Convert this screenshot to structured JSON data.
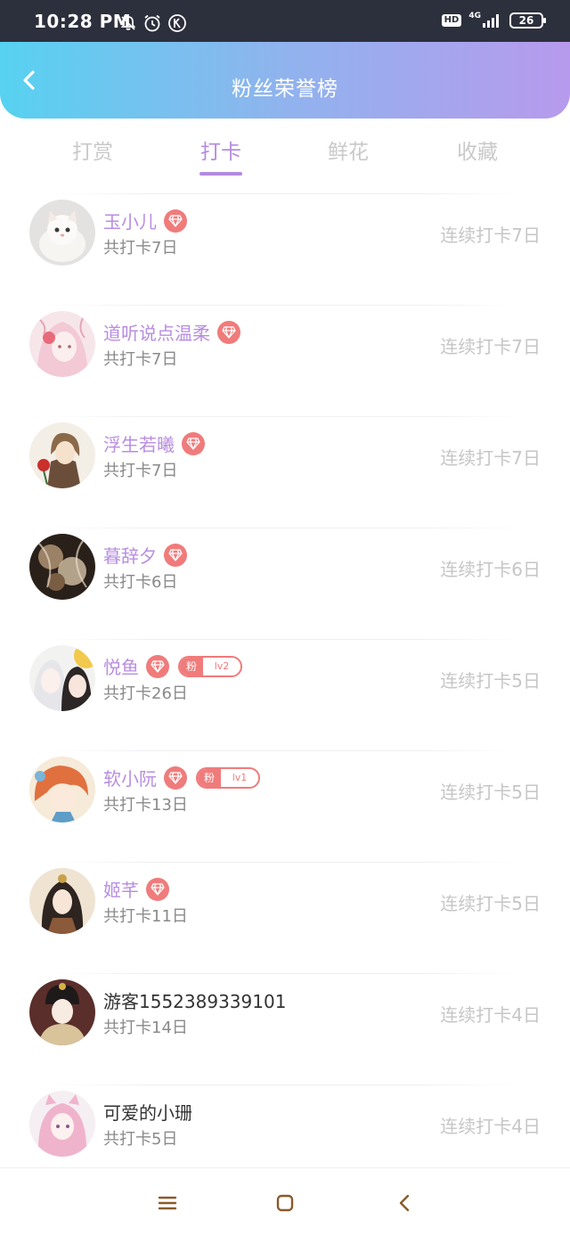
{
  "status_bar": {
    "time": "10:28 PM",
    "hd": "HD",
    "network": "4G",
    "battery": "26",
    "icons": [
      "bell-off-icon",
      "alarm-icon",
      "k-app-icon",
      "signal-icon",
      "battery-icon"
    ]
  },
  "header": {
    "title": "粉丝荣誉榜",
    "back_icon": "chevron-left-icon"
  },
  "tabs": [
    {
      "label": "打赏",
      "active": false
    },
    {
      "label": "打卡",
      "active": true
    },
    {
      "label": "鲜花",
      "active": false
    },
    {
      "label": "收藏",
      "active": false
    }
  ],
  "colors": {
    "accent": "#b48be0",
    "header_gradient_start": "#57d2f0",
    "header_gradient_end": "#b79aed",
    "badge": "#f07b7b",
    "streak_text": "#c6c6c6"
  },
  "fans": [
    {
      "name": "玉小儿",
      "total": "共打卡7日",
      "streak": "连续打卡7日",
      "vip": true,
      "fan_level": null,
      "avatar": "white-kitten"
    },
    {
      "name": "道听说点温柔",
      "total": "共打卡7日",
      "streak": "连续打卡7日",
      "vip": true,
      "fan_level": null,
      "avatar": "pink-anime-girl"
    },
    {
      "name": "浮生若曦",
      "total": "共打卡7日",
      "streak": "连续打卡7日",
      "vip": true,
      "fan_level": null,
      "avatar": "boy-with-rose"
    },
    {
      "name": "暮辞夕",
      "total": "共打卡6日",
      "streak": "连续打卡6日",
      "vip": true,
      "fan_level": null,
      "avatar": "sepia-artwork"
    },
    {
      "name": "悦鱼",
      "total": "共打卡26日",
      "streak": "连续打卡5日",
      "vip": true,
      "fan_level": {
        "prefix": "粉",
        "level": "lv2"
      },
      "avatar": "two-anime-girls"
    },
    {
      "name": "软小阮",
      "total": "共打卡13日",
      "streak": "连续打卡5日",
      "vip": true,
      "fan_level": {
        "prefix": "粉",
        "level": "lv1"
      },
      "avatar": "orange-haired-girl"
    },
    {
      "name": "姬芊",
      "total": "共打卡11日",
      "streak": "连续打卡5日",
      "vip": true,
      "fan_level": null,
      "avatar": "ancient-costume-girl"
    },
    {
      "name": "游客1552389339101",
      "total": "共打卡14日",
      "streak": "连续打卡4日",
      "vip": false,
      "fan_level": null,
      "avatar": "palace-lady"
    },
    {
      "name": "可爱的小珊",
      "total": "共打卡5日",
      "streak": "连续打卡4日",
      "vip": false,
      "fan_level": null,
      "avatar": "pink-haired-girl"
    }
  ],
  "nav_bar": {
    "icons": [
      "menu-icon",
      "home-square-icon",
      "back-chevron-icon"
    ]
  }
}
